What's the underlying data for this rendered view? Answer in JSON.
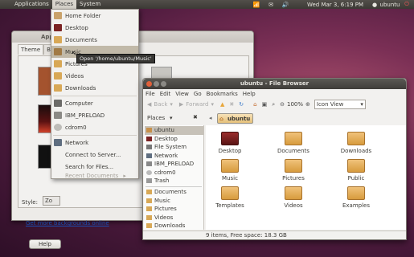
{
  "panel": {
    "applications": "Applications",
    "places": "Places",
    "system": "System",
    "clock": "Wed Mar 3, 6:19 PM",
    "user": "ubuntu"
  },
  "appearance": {
    "title": "App",
    "tabs": [
      "Theme",
      "Bac"
    ],
    "style_label": "Style:",
    "style_value": "Zo",
    "bg_link": "Get more backgrounds online",
    "help": "Help"
  },
  "places_menu": {
    "items": [
      "Home Folder",
      "Desktop",
      "Documents",
      "Music",
      "Pictures",
      "Videos",
      "Downloads",
      "Computer",
      "IBM_PRELOAD",
      "cdrom0",
      "Network",
      "Connect to Server...",
      "Search for Files...",
      "Recent Documents"
    ],
    "tooltip": "Open '/home/ubuntu/Music'"
  },
  "file_browser": {
    "title": "ubuntu - File Browser",
    "menu": [
      "File",
      "Edit",
      "View",
      "Go",
      "Bookmarks",
      "Help"
    ],
    "back": "Back",
    "forward": "Forward",
    "zoom": "100%",
    "view_mode": "Icon View",
    "places_label": "Places",
    "location": "ubuntu",
    "sidebar": [
      "ubuntu",
      "Desktop",
      "File System",
      "Network",
      "IBM_PRELOAD",
      "cdrom0",
      "Trash",
      "Documents",
      "Music",
      "Pictures",
      "Videos",
      "Downloads"
    ],
    "items": [
      "Desktop",
      "Documents",
      "Downloads",
      "Music",
      "Pictures",
      "Public",
      "Templates",
      "Videos",
      "Examples"
    ],
    "status": "9 items, Free space: 18.3 GB"
  }
}
